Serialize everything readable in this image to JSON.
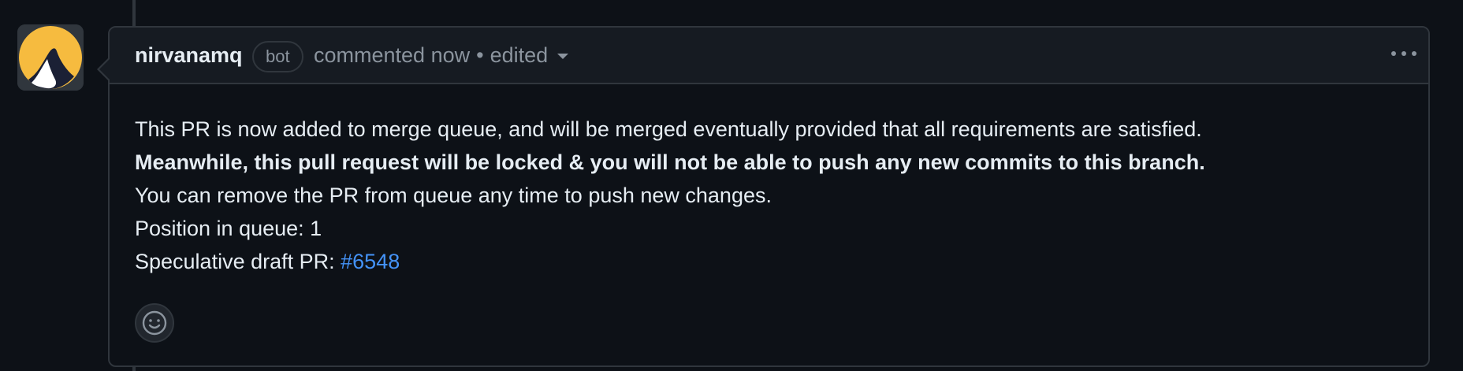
{
  "comment": {
    "author": "nirvanamq",
    "badge": "bot",
    "commented": "commented now",
    "separator": "•",
    "edited": "edited",
    "body": {
      "line1": "This PR is now added to merge queue, and will be merged eventually provided that all requirements are satisfied.",
      "line2": "Meanwhile, this pull request will be locked & you will not be able to push any new commits to this branch.",
      "line3": "You can remove the PR from queue any time to push new changes.",
      "line4": "Position in queue: 1",
      "line5_prefix": "Speculative draft PR: ",
      "line5_link": "#6548"
    }
  },
  "icons": {
    "avatar": "nirvana-logo-icon",
    "menu": "kebab-horizontal-icon",
    "dropdown": "triangle-down-icon",
    "reaction": "smiley-icon"
  },
  "colors": {
    "background": "#0d1117",
    "header": "#161b22",
    "border": "#30363d",
    "text": "#e6edf3",
    "muted": "#8b949e",
    "link": "#4493f8",
    "avatar_yellow": "#f6bb3f",
    "avatar_navy": "#1b2035"
  }
}
